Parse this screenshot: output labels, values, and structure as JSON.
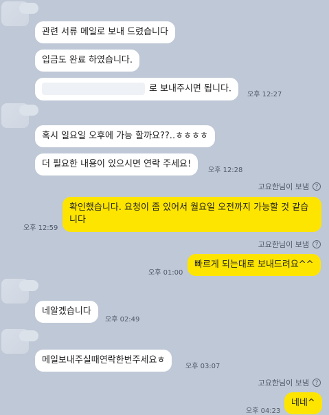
{
  "messages": {
    "m1": "관련 서류 메일로 보내 드렸습니다",
    "m2": "입금도 완료 하였습니다.",
    "m3": "로 보내주시면 됩니다.",
    "m4": "혹시 일요일 오후에 가능 할까요??..ㅎㅎㅎㅎ",
    "m5": "더 필요한 내용이 있으시면 연락 주세요!",
    "m6": "확인했습니다. 요청이 좀 있어서 월요일 오전까지 가능할 것 같습니다",
    "m7": "빠르게 되는대로 보내드려요^^",
    "m8": "네알겠습니다",
    "m9": "메일보내주실때연락한번주세요ㅎ",
    "m10": "네네^"
  },
  "times": {
    "t1": "오후 12:27",
    "t2": "오후 12:28",
    "t3": "오후 12:59",
    "t4": "오후 01:00",
    "t5": "오후 02:49",
    "t6": "오후 03:07",
    "t7": "오후 04:23"
  },
  "read_label": "고요한님이 보냄",
  "help_icon_glyph": "?"
}
